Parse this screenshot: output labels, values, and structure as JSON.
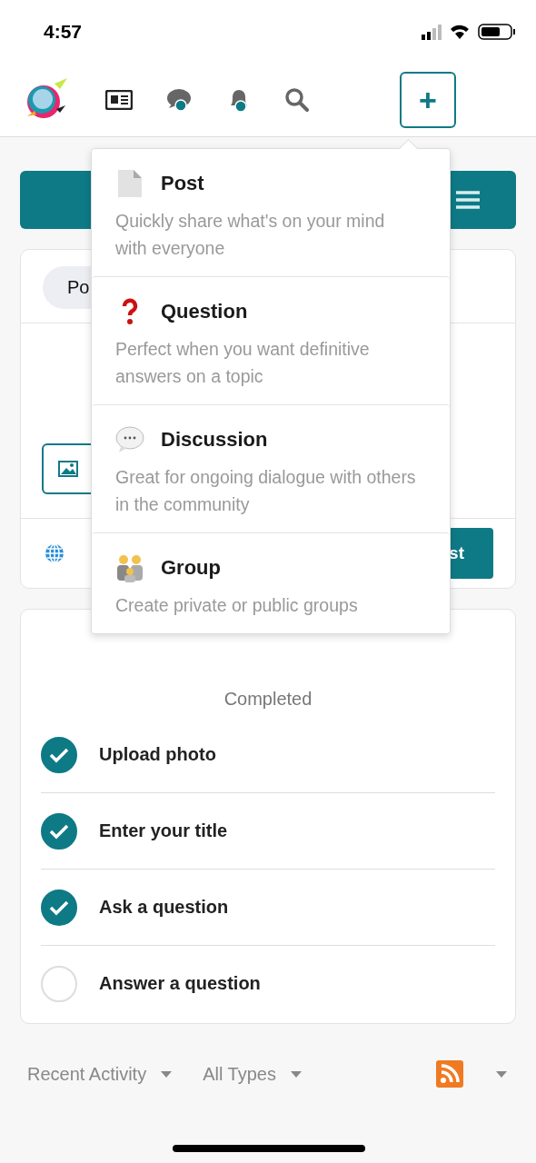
{
  "status_bar": {
    "time": "4:57"
  },
  "header": {
    "add_button": {
      "label": "+",
      "expanded": true
    }
  },
  "composer": {
    "tab": "Po",
    "submit": "st"
  },
  "create_menu": [
    {
      "kind": "post",
      "title": "Post",
      "description": "Quickly share what's on your mind with everyone"
    },
    {
      "kind": "question",
      "title": "Question",
      "description": "Perfect when you want definitive answers on a topic"
    },
    {
      "kind": "discussion",
      "title": "Discussion",
      "description": "Great for ongoing dialogue with others in the community"
    },
    {
      "kind": "group",
      "title": "Group",
      "description": "Create private or public groups"
    }
  ],
  "progress": {
    "caption": "Completed"
  },
  "checklist": [
    {
      "label": "Upload photo",
      "checked": true
    },
    {
      "label": "Enter your title",
      "checked": true
    },
    {
      "label": "Ask a question",
      "checked": true
    },
    {
      "label": "Answer a question",
      "checked": false
    }
  ],
  "filters": [
    {
      "label": "Recent Activity"
    },
    {
      "label": "All Types"
    }
  ]
}
